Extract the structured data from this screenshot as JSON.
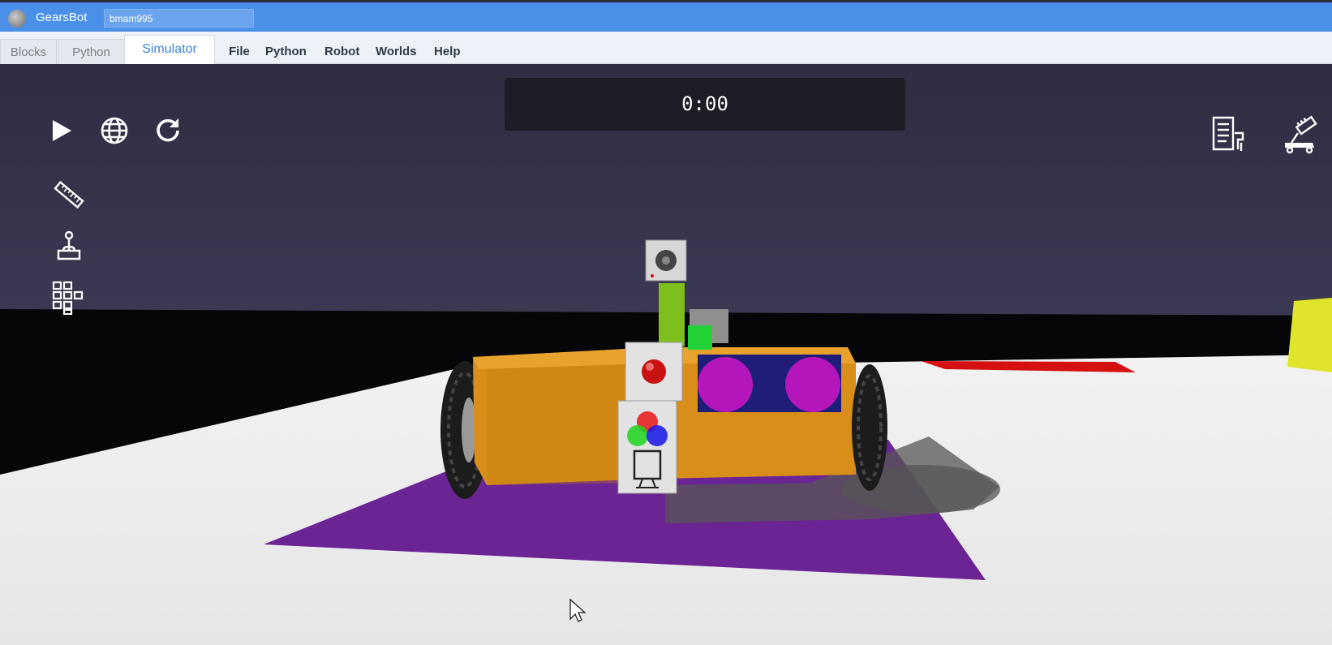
{
  "app": {
    "name": "GearsBot",
    "project_name": "bmam995"
  },
  "tabs": [
    {
      "label": "Blocks",
      "active": false
    },
    {
      "label": "Python",
      "active": false
    },
    {
      "label": "Simulator",
      "active": true
    }
  ],
  "menu": {
    "file": "File",
    "python": "Python",
    "robot": "Robot",
    "worlds": "Worlds",
    "help": "Help"
  },
  "simulator": {
    "timer": "0:00"
  },
  "toolbar_icons": [
    "play-icon",
    "globe-icon",
    "reset-icon",
    "ruler-icon",
    "joystick-icon",
    "blocks-icon",
    "code-panel-icon",
    "robot-config-icon"
  ],
  "colors": {
    "title_bar": "#4a90e8",
    "sky": "#36334a",
    "floor": "#ececec",
    "mat": "#6b2494",
    "robot_body": "#d88e18",
    "active_tab_text": "#3f84d8"
  }
}
